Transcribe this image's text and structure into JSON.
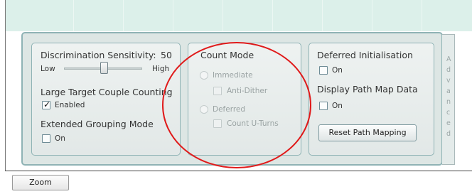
{
  "discrimination": {
    "label": "Discrimination Sensitivity:",
    "value": "50",
    "low_label": "Low",
    "high_label": "High",
    "slider_level_fraction": 0.5
  },
  "large_target": {
    "label": "Large Target Couple Counting",
    "checkbox_label": "Enabled",
    "checked": true
  },
  "extended_grouping": {
    "label": "Extended Grouping Mode",
    "checkbox_label": "On",
    "checked": false
  },
  "count_mode": {
    "label": "Count Mode",
    "immediate_label": "Immediate",
    "anti_dither_label": "Anti-Dither",
    "deferred_label": "Deferred",
    "count_uturns_label": "Count U-Turns"
  },
  "deferred_init": {
    "label": "Deferred Initialisation",
    "checkbox_label": "On",
    "checked": false
  },
  "display_path": {
    "label": "Display Path Map Data",
    "checkbox_label": "On",
    "checked": false
  },
  "reset_button_label": "Reset Path Mapping",
  "advanced_tab_letters": [
    "A",
    "d",
    "v",
    "a",
    "n",
    "c",
    "e",
    "d"
  ],
  "zoom_button_label": "Zoom",
  "colors": {
    "panel_border": "#8fb3b5",
    "top_area": "#dcf0ea",
    "annotation": "#e01a1a"
  }
}
